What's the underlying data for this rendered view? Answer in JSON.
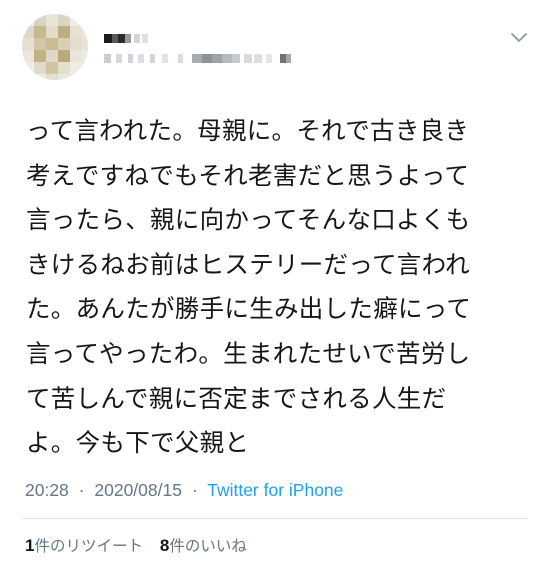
{
  "tweet": {
    "text_lines": [
      "って言われた。母親に。それで古き良き",
      "考えですねでもそれ老害だと思うよって",
      "言ったら、親に向かってそんな口よくも",
      "きけるねお前はヒステリーだって言われ",
      "た。あんたが勝手に生み出した癖にって",
      "言ってやったわ。生まれたせいで苦労し",
      "て苦しんで親に否定までされる人生だ",
      "よ。今も下で父親と"
    ],
    "time": "20:28",
    "separator": "·",
    "date": "2020/08/15",
    "source": "Twitter for iPhone",
    "retweets": {
      "count": "1",
      "label": "件のリツイート"
    },
    "likes": {
      "count": "8",
      "label": "件のいいね"
    }
  },
  "colors": {
    "text": "#14171a",
    "secondary": "#657786",
    "link": "#1da1f2",
    "divider": "#e1e8ed"
  },
  "icons": {
    "menu": "chevron-down-icon"
  }
}
